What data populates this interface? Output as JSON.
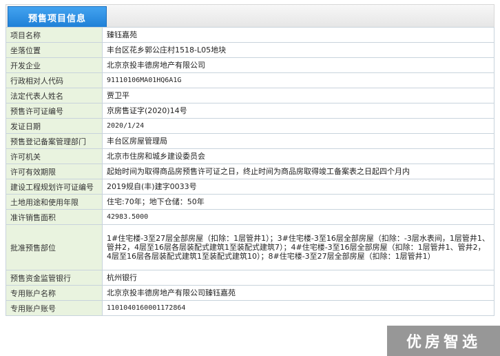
{
  "tab": {
    "title": "预售项目信息"
  },
  "rows": [
    {
      "label": "项目名称",
      "value": "臻钰嘉苑"
    },
    {
      "label": "坐落位置",
      "value": "丰台区花乡郭公庄村1518-L05地块"
    },
    {
      "label": "开发企业",
      "value": "北京京投丰德房地产有限公司"
    },
    {
      "label": "行政相对人代码",
      "value": "91110106MA01HQ6A1G"
    },
    {
      "label": "法定代表人姓名",
      "value": "贾卫平"
    },
    {
      "label": "预售许可证编号",
      "value": "京房售证字(2020)14号"
    },
    {
      "label": "发证日期",
      "value": "2020/1/24"
    },
    {
      "label": "预售登记备案管理部门",
      "value": "丰台区房屋管理局"
    },
    {
      "label": "许可机关",
      "value": "北京市住房和城乡建设委员会"
    },
    {
      "label": "许可有效期限",
      "value": "起始时间为取得商品房预售许可证之日，终止时间为商品房取得竣工备案表之日起四个月内"
    },
    {
      "label": "建设工程规划许可证编号",
      "value": "2019规自(丰)建字0033号"
    },
    {
      "label": "土地用途和使用年限",
      "value": "住宅:70年；地下仓储：50年"
    },
    {
      "label": "准许销售面积",
      "value": "42983.5000"
    },
    {
      "label": "批准预售部位",
      "value": "1#住宅楼-3至27层全部房屋（扣除：1层管井1）；3#住宅楼-3至16层全部房屋（扣除：-3层水表间，1层管井1、管井2，4层至16层各层装配式建筑1至装配式建筑7）；4#住宅楼-3至16层全部房屋（扣除：1层管井1、管井2，4层至16层各层装配式建筑1至装配式建筑10）；8#住宅楼-3至27层全部房屋（扣除：1层管井1）"
    },
    {
      "label": "预售资金监管银行",
      "value": "杭州银行"
    },
    {
      "label": "专用账户名称",
      "value": "北京京投丰德房地产有限公司臻钰嘉苑"
    },
    {
      "label": "专用账户账号",
      "value": "1101040160001172864"
    }
  ],
  "watermark": "优房智选"
}
